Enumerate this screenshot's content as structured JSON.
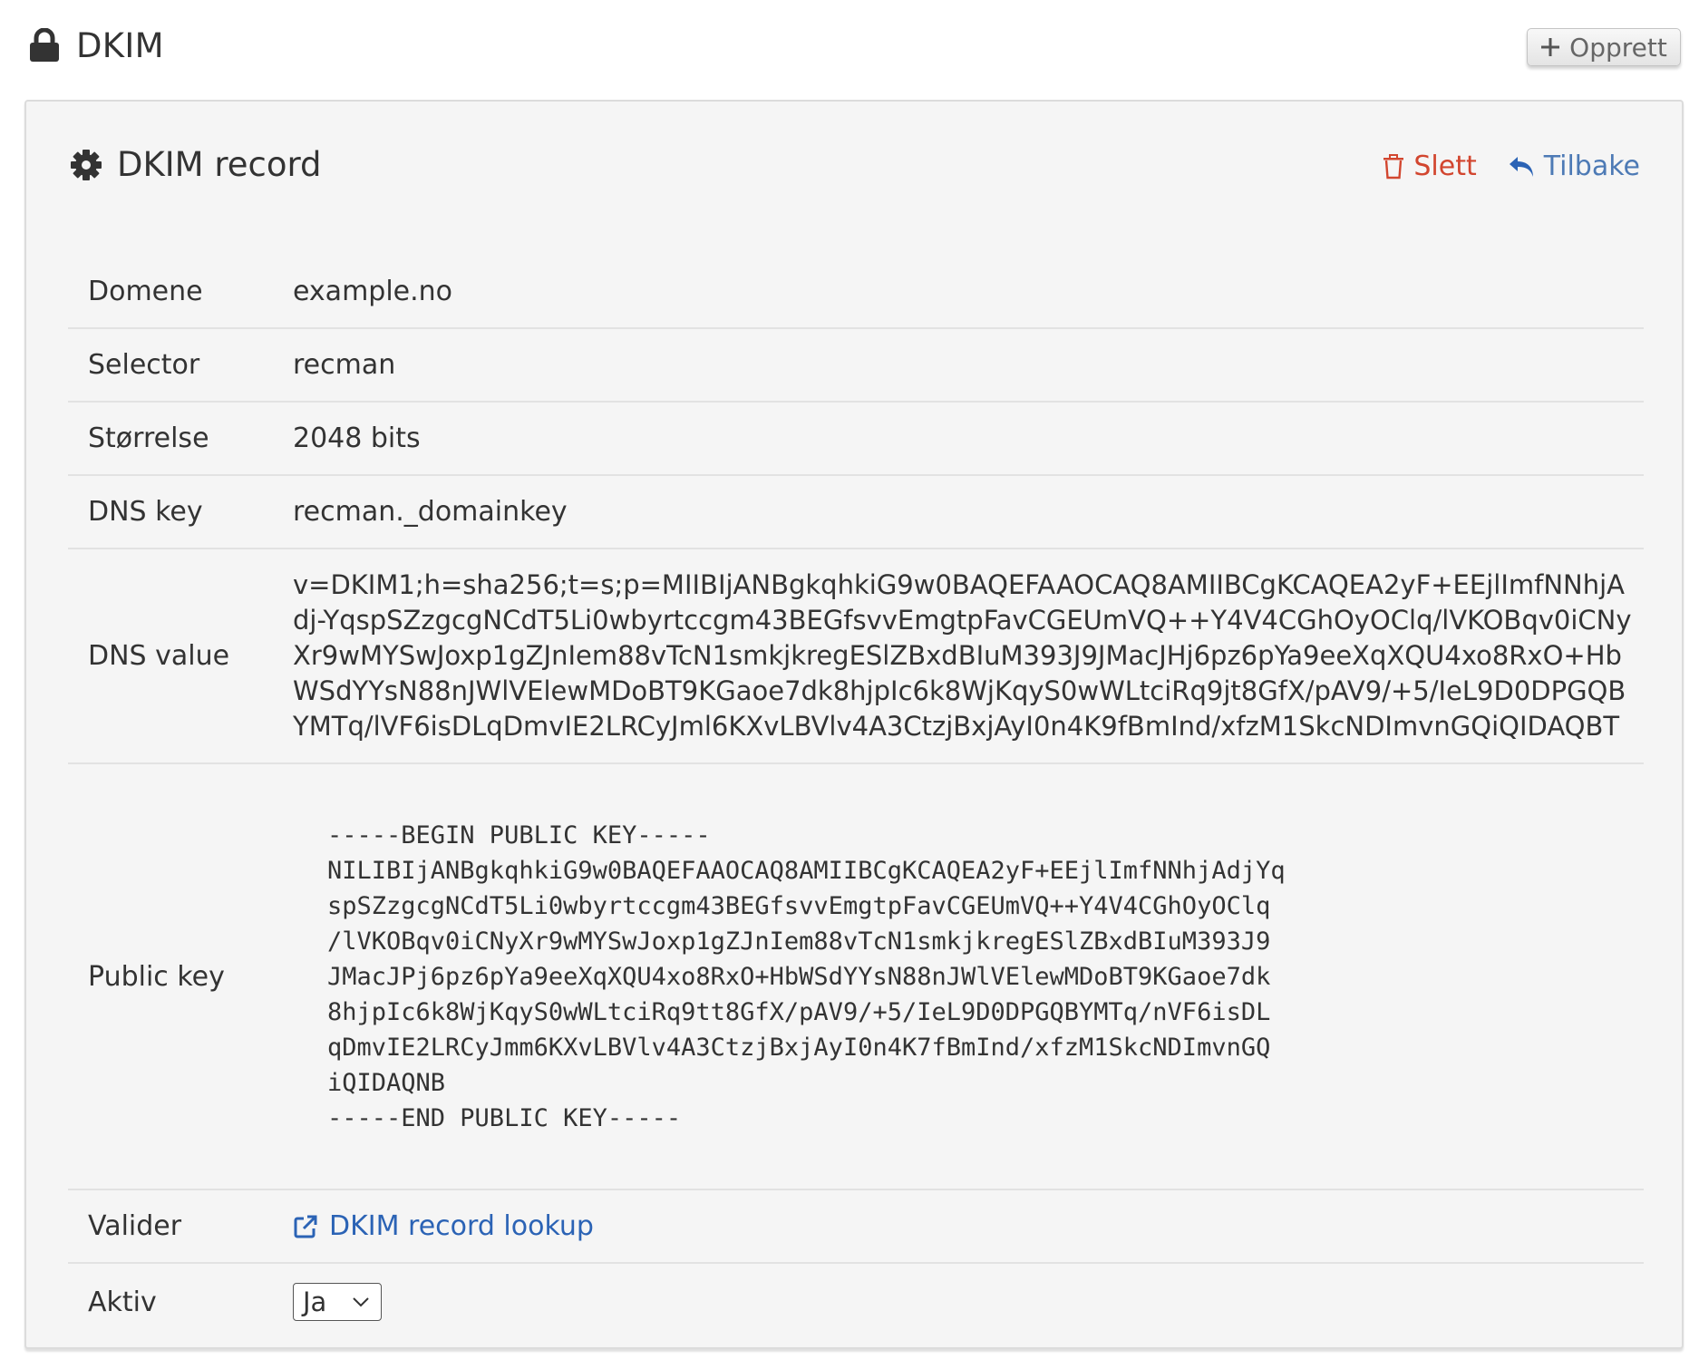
{
  "header": {
    "title": "DKIM",
    "title_icon": "lock-icon",
    "create_label": "Opprett",
    "create_icon": "plus-icon"
  },
  "card": {
    "title": "DKIM record",
    "title_icon": "gear-icon",
    "delete_label": "Slett",
    "delete_icon": "trash-icon",
    "back_label": "Tilbake",
    "back_icon": "reply-arrow-icon"
  },
  "details": {
    "domain_label": "Domene",
    "domain_value": "example.no",
    "selector_label": "Selector",
    "selector_value": "recman",
    "size_label": "Størrelse",
    "size_value": "2048 bits",
    "dns_key_label": "DNS key",
    "dns_key_value": "recman._domainkey",
    "dns_value_label": "DNS value",
    "dns_value_value": "v=DKIM1;h=sha256;t=s;p=MIIBIjANBgkqhkiG9w0BAQEFAAOCAQ8AMIIBCgKCAQEA2yF+EEjlImfNNhjAdj-YqspSZzgcgNCdT5Li0wbyrtccgm43BEGfsvvEmgtpFavCGEUmVQ++Y4V4CGhOyOClq/lVKOBqv0iCNyXr9wMYSwJoxp1gZJnIem88vTcN1smkjkregESlZBxdBIuM393J9JMacJHj6pz6pYa9eeXqXQU4xo8RxO+HbWSdYYsN88nJWlVElewMDoBT9KGaoe7dk8hjpIc6k8WjKqyS0wWLtciRq9jt8GfX/pAV9/+5/IeL9D0DPGQBYMTq/lVF6isDLqDmvIE2LRCyJml6KXvLBVlv4A3CtzjBxjAyI0n4K9fBmInd/xfzM1SkcNDImvnGQiQIDAQBT",
    "public_key_label": "Public key",
    "public_key_value": "-----BEGIN PUBLIC KEY-----\nNILIBIjANBgkqhkiG9w0BAQEFAAOCAQ8AMIIBCgKCAQEA2yF+EEjlImfNNhjAdjYq\nspSZzgcgNCdT5Li0wbyrtccgm43BEGfsvvEmgtpFavCGEUmVQ++Y4V4CGhOyOClq\n/lVKOBqv0iCNyXr9wMYSwJoxp1gZJnIem88vTcN1smkjkregESlZBxdBIuM393J9\nJMacJPj6pz6pYa9eeXqXQU4xo8RxO+HbWSdYYsN88nJWlVElewMDoBT9KGaoe7dk\n8hjpIc6k8WjKqyS0wWLtciRq9tt8GfX/pAV9/+5/IeL9D0DPGQBYMTq/nVF6isDL\nqDmvIE2LRCyJmm6KXvLBVlv4A3CtzjBxjAyI0n4K7fBmInd/xfzM1SkcNDImvnGQ\niQIDAQNB\n-----END PUBLIC KEY-----",
    "validate_label": "Valider",
    "validate_link": "DKIM record lookup",
    "validate_icon": "external-link-icon",
    "active_label": "Aktiv",
    "active_value": "Ja",
    "active_icon": "chevron-down-icon"
  },
  "colors": {
    "link": "#2b63b5",
    "delete": "#d2462f",
    "back": "#4d7ab5",
    "card_background": "#f5f5f5"
  }
}
